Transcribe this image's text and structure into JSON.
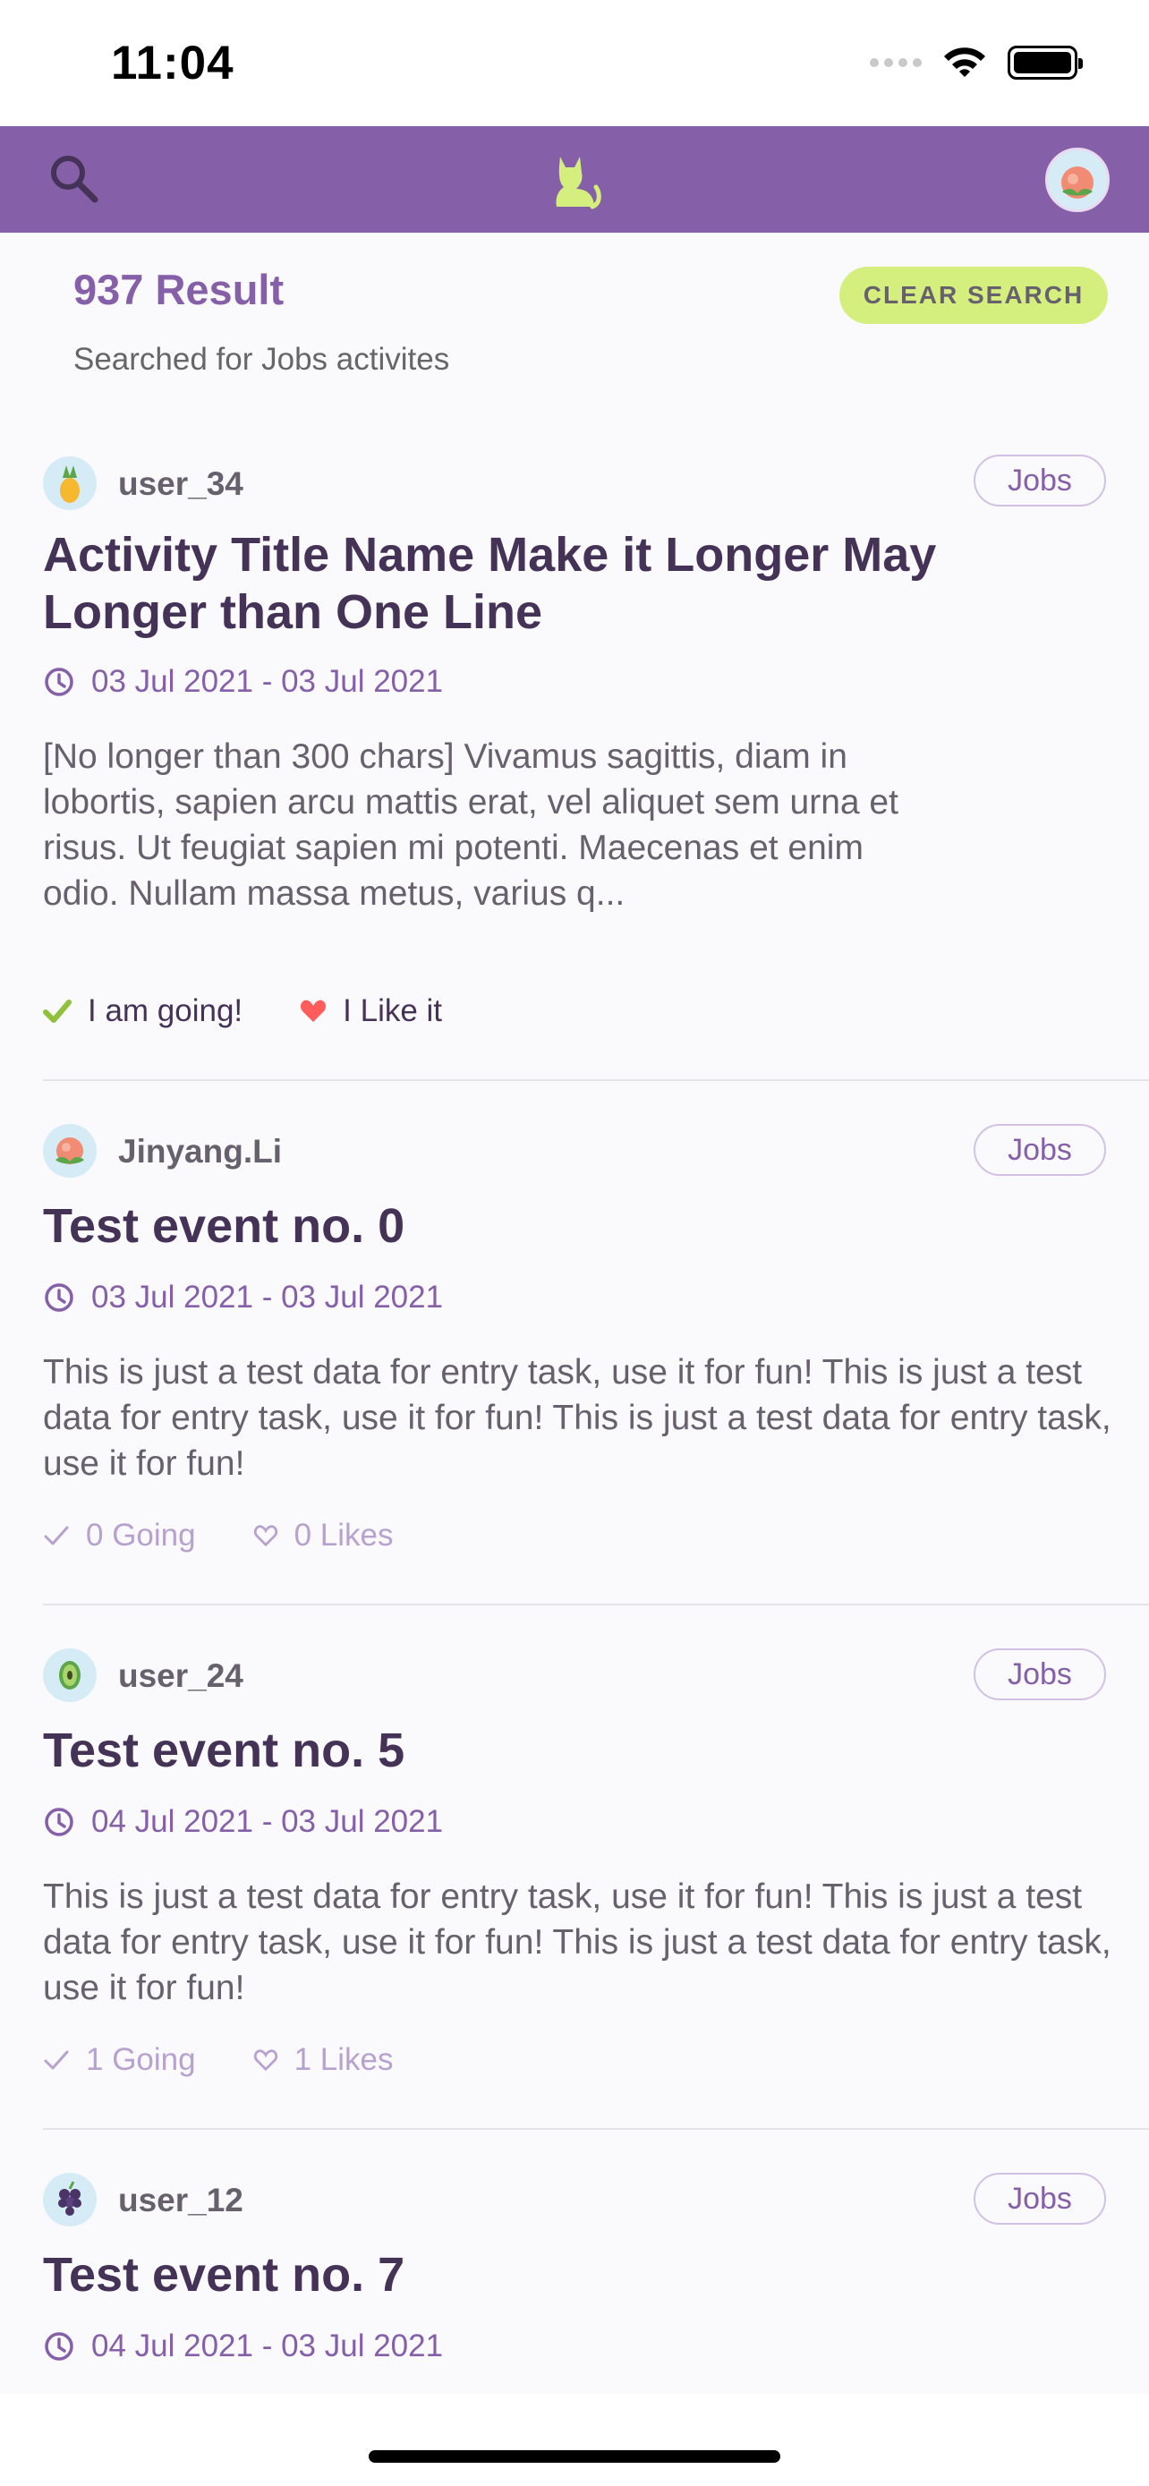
{
  "status": {
    "time": "11:04"
  },
  "header": {
    "search_icon": "search-icon",
    "logo_icon": "cat-logo-icon",
    "avatar_icon": "peach-avatar"
  },
  "results": {
    "count": "937 Result",
    "subtitle": "Searched for Jobs activites",
    "clear_label": "CLEAR SEARCH"
  },
  "cards": [
    {
      "user": "user_34",
      "avatar": "pineapple-avatar",
      "tag": "Jobs",
      "title": "Activity Title Name Make it Longer May Longer than One Line",
      "date": "03 Jul 2021 - 03 Jul 2021",
      "desc": "[No longer than 300 chars] Vivamus sagittis, diam in lobortis, sapien arcu mattis erat, vel aliquet sem urna et risus. Ut feugiat sapien mi potenti. Maecenas et enim odio. Nullam massa metus, varius q...",
      "going": "I am going!",
      "likes": "I Like it"
    },
    {
      "user": "Jinyang.Li",
      "avatar": "peach-avatar",
      "tag": "Jobs",
      "title": "Test event no. 0",
      "date": "03 Jul 2021 - 03 Jul 2021",
      "desc": "This is just a test data for entry task, use it for fun! This is just a test data for entry task, use it for fun! This is just a test data for entry task, use it for fun!",
      "going": "0 Going",
      "likes": "0 Likes"
    },
    {
      "user": "user_24",
      "avatar": "kiwi-avatar",
      "tag": "Jobs",
      "title": "Test event no. 5",
      "date": "04 Jul 2021 - 03 Jul 2021",
      "desc": "This is just a test data for entry task, use it for fun! This is just a test data for entry task, use it for fun! This is just a test data for entry task, use it for fun!",
      "going": "1 Going",
      "likes": "1 Likes"
    },
    {
      "user": "user_12",
      "avatar": "grapes-avatar",
      "tag": "Jobs",
      "title": "Test event no. 7",
      "date": "04 Jul 2021 - 03 Jul 2021"
    }
  ],
  "colors": {
    "primary": "#8560a9",
    "accent": "#d5ef7f",
    "heart": "#ff5c5c",
    "check": "#8fc13a"
  }
}
